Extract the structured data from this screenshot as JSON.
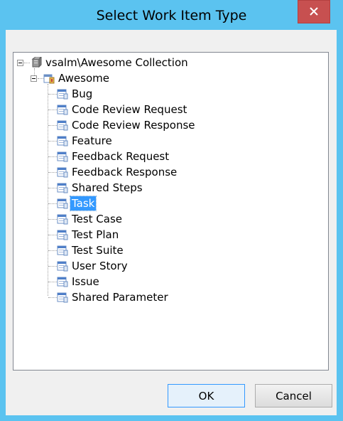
{
  "window": {
    "title": "Select Work Item Type",
    "close_glyph": "✕"
  },
  "tree": {
    "root": {
      "label": "vsalm\\Awesome Collection",
      "icon": "server-collection-icon"
    },
    "project": {
      "label": "Awesome",
      "icon": "team-project-icon"
    },
    "items": [
      {
        "label": "Bug",
        "icon": "work-item-type-icon",
        "selected": false
      },
      {
        "label": "Code Review Request",
        "icon": "work-item-type-icon",
        "selected": false
      },
      {
        "label": "Code Review Response",
        "icon": "work-item-type-icon",
        "selected": false
      },
      {
        "label": "Feature",
        "icon": "work-item-type-icon",
        "selected": false
      },
      {
        "label": "Feedback Request",
        "icon": "work-item-type-icon",
        "selected": false
      },
      {
        "label": "Feedback Response",
        "icon": "work-item-type-icon",
        "selected": false
      },
      {
        "label": "Shared Steps",
        "icon": "work-item-type-icon",
        "selected": false
      },
      {
        "label": "Task",
        "icon": "work-item-type-icon",
        "selected": true
      },
      {
        "label": "Test Case",
        "icon": "work-item-type-icon",
        "selected": false
      },
      {
        "label": "Test Plan",
        "icon": "work-item-type-icon",
        "selected": false
      },
      {
        "label": "Test Suite",
        "icon": "work-item-type-icon",
        "selected": false
      },
      {
        "label": "User Story",
        "icon": "work-item-type-icon",
        "selected": false
      },
      {
        "label": "Issue",
        "icon": "work-item-type-icon",
        "selected": false
      },
      {
        "label": "Shared Parameter",
        "icon": "work-item-type-icon",
        "selected": false
      }
    ]
  },
  "buttons": {
    "ok_label": "OK",
    "cancel_label": "Cancel"
  },
  "colors": {
    "title_bar": "#5bc3f0",
    "close_button": "#c75050",
    "selection": "#3399ff"
  }
}
